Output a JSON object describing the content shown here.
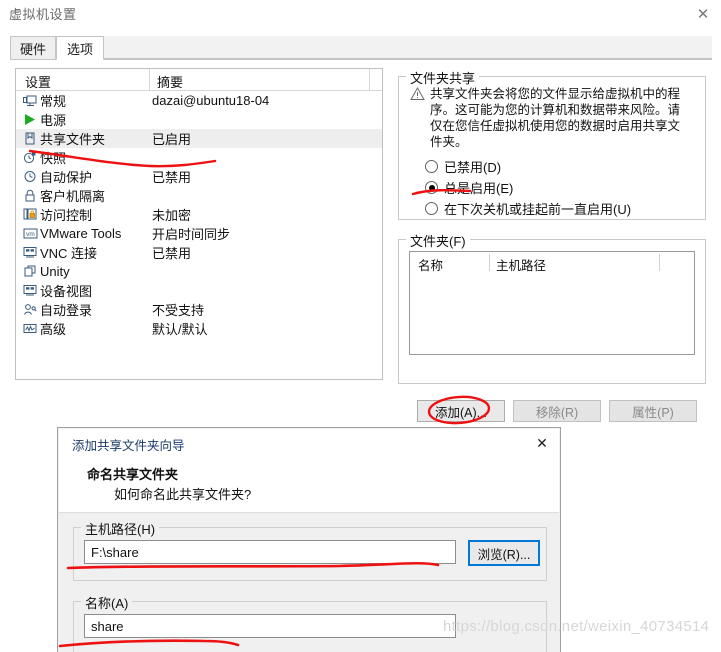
{
  "window": {
    "title": "虚拟机设置",
    "close_label": "✕"
  },
  "tabs": [
    {
      "label": "硬件",
      "active": false
    },
    {
      "label": "选项",
      "active": true
    }
  ],
  "settings_list": {
    "columns": [
      "设置",
      "摘要"
    ],
    "rows": [
      {
        "icon": "monitor-icon",
        "label": "常规",
        "summary": "dazai@ubuntu18-04",
        "selected": false
      },
      {
        "icon": "power-play-icon",
        "label": "电源",
        "summary": "",
        "selected": false
      },
      {
        "icon": "shared-folder-icon",
        "label": "共享文件夹",
        "summary": "已启用",
        "selected": true
      },
      {
        "icon": "snapshot-clock-icon",
        "label": "快照",
        "summary": "",
        "selected": false
      },
      {
        "icon": "autoprotect-clock-icon",
        "label": "自动保护",
        "summary": "已禁用",
        "selected": false
      },
      {
        "icon": "padlock-icon",
        "label": "客户机隔离",
        "summary": "",
        "selected": false
      },
      {
        "icon": "access-control-icon",
        "label": "访问控制",
        "summary": "未加密",
        "selected": false
      },
      {
        "icon": "vmware-tools-icon",
        "label": "VMware Tools",
        "summary": "开启时间同步",
        "selected": false
      },
      {
        "icon": "vnc-icon",
        "label": "VNC 连接",
        "summary": "已禁用",
        "selected": false
      },
      {
        "icon": "unity-icon",
        "label": "Unity",
        "summary": "",
        "selected": false
      },
      {
        "icon": "device-view-icon",
        "label": "设备视图",
        "summary": "",
        "selected": false
      },
      {
        "icon": "auto-login-icon",
        "label": "自动登录",
        "summary": "不受支持",
        "selected": false
      },
      {
        "icon": "advanced-icon",
        "label": "高级",
        "summary": "默认/默认",
        "selected": false
      }
    ]
  },
  "folder_sharing": {
    "legend": "文件夹共享",
    "warning_icon": "warning-triangle-icon",
    "warning_text": "共享文件夹会将您的文件显示给虚拟机中的程序。这可能为您的计算机和数据带来风险。请仅在您信任虚拟机使用您的数据时启用共享文件夹。",
    "options": [
      {
        "label": "已禁用(D)",
        "selected": false
      },
      {
        "label": "总是启用(E)",
        "selected": true
      },
      {
        "label": "在下次关机或挂起前一直启用(U)",
        "selected": false
      }
    ]
  },
  "folders": {
    "legend": "文件夹(F)",
    "columns": [
      "名称",
      "主机路径"
    ],
    "rows": [],
    "buttons": [
      {
        "label": "添加(A)...",
        "enabled": true
      },
      {
        "label": "移除(R)",
        "enabled": false
      },
      {
        "label": "属性(P)",
        "enabled": false
      }
    ]
  },
  "wizard": {
    "title": "添加共享文件夹向导",
    "close_label": "✕",
    "heading": "命名共享文件夹",
    "subheading": "如何命名此共享文件夹?",
    "host_path": {
      "legend": "主机路径(H)",
      "value": "F:\\share",
      "placeholder": ""
    },
    "browse_button": "浏览(R)...",
    "name": {
      "legend": "名称(A)",
      "value": "share",
      "placeholder": ""
    }
  },
  "watermark": "https://blog.csdn.net/weixin_40734514",
  "colors": {
    "accent": "#0078d7",
    "annotation": "#ee1111",
    "selected_row": "#eeeeee"
  }
}
